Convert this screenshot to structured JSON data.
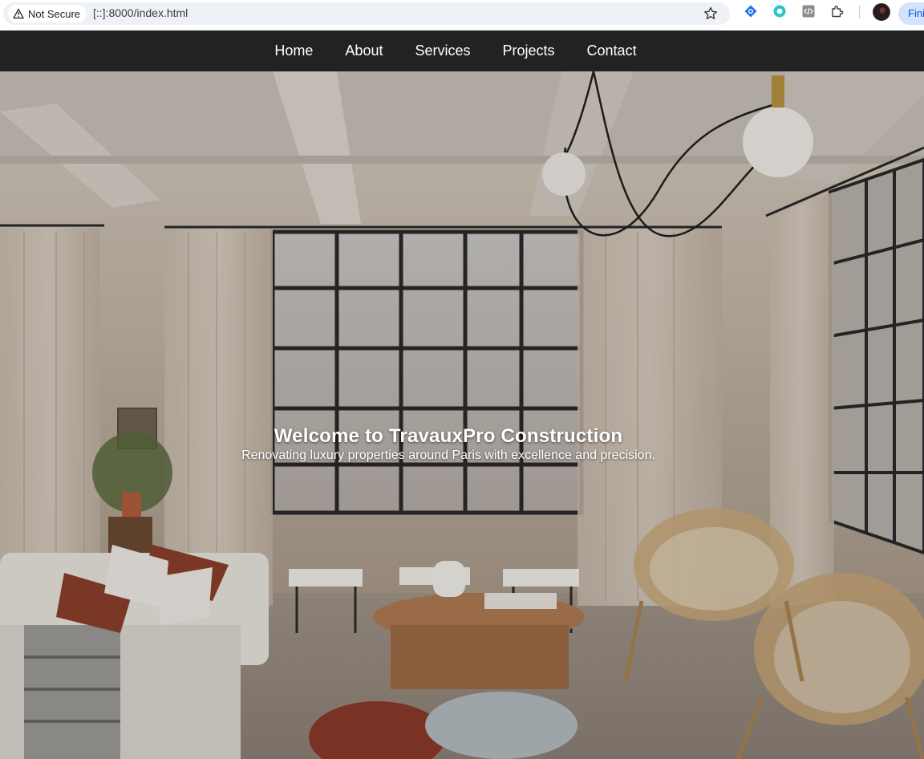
{
  "browser": {
    "security_label": "Not Secure",
    "url": "[::]:8000/index.html",
    "profile_chip_label": "Fini"
  },
  "nav": {
    "items": [
      {
        "label": "Home"
      },
      {
        "label": "About"
      },
      {
        "label": "Services"
      },
      {
        "label": "Projects"
      },
      {
        "label": "Contact"
      }
    ]
  },
  "hero": {
    "title": "Welcome to TravauxPro Construction",
    "subtitle": "Renovating luxury properties around Paris with excellence and precision.",
    "image_icon": "living-room-photo"
  },
  "colors": {
    "nav_background": "#222222",
    "nav_text": "#ffffff",
    "hero_text": "#ffffff"
  }
}
